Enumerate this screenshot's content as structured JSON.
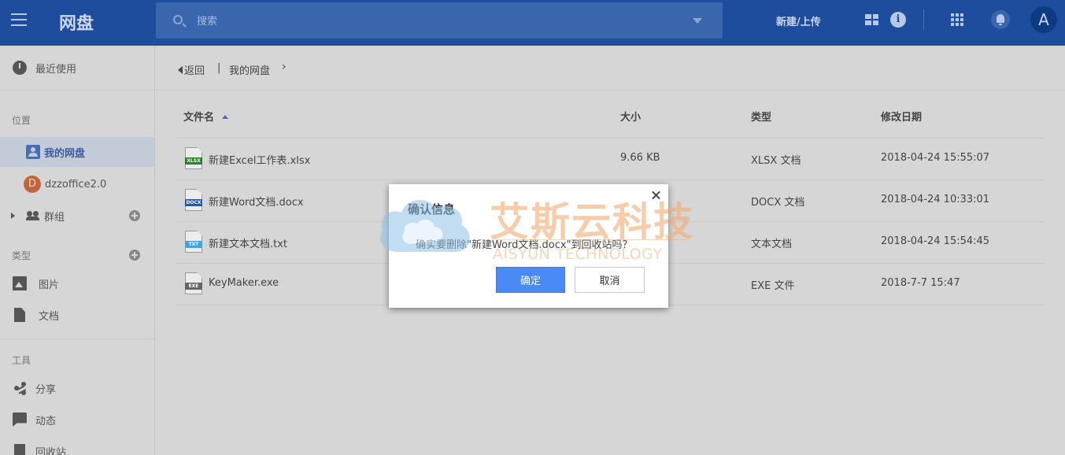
{
  "header": {
    "brand": "网盘",
    "search_placeholder": "搜索",
    "new_upload": "新建/上传",
    "info_glyph": "i",
    "avatar_letter": "A"
  },
  "sidebar": {
    "recent": "最近使用",
    "location_section": "位置",
    "my_drive": "我的网盘",
    "org_avatar": "D",
    "org_name": "dzzoffice2.0",
    "groups": "群组",
    "type_section": "类型",
    "images": "图片",
    "documents": "文档",
    "tools_section": "工具",
    "share": "分享",
    "activity": "动态",
    "recycle": "回收站"
  },
  "breadcrumb": {
    "back": "返回",
    "separator": "|",
    "root": "我的网盘",
    "chevron": "›"
  },
  "table": {
    "headers": {
      "name": "文件名",
      "size": "大小",
      "type": "类型",
      "modified": "修改日期"
    },
    "rows": [
      {
        "icon": "XLSX",
        "name": "新建Excel工作表.xlsx",
        "size": "9.66 KB",
        "type": "XLSX 文档",
        "modified": "2018-04-24 15:55:07"
      },
      {
        "icon": "DOCX",
        "name": "新建Word文档.docx",
        "size": "",
        "type": "DOCX 文档",
        "modified": "2018-04-24 10:33:01"
      },
      {
        "icon": "TXT",
        "name": "新建文本文档.txt",
        "size": "",
        "type": "文本文档",
        "modified": "2018-04-24 15:54:45"
      },
      {
        "icon": "EXE",
        "name": "KeyMaker.exe",
        "size": "",
        "type": "EXE 文件",
        "modified": "2018-7-7 15:47"
      }
    ]
  },
  "dialog": {
    "title": "确认信息",
    "message": "确实要删除\"新建Word文档.docx\"到回收站吗？",
    "ok": "确定",
    "cancel": "取消"
  },
  "watermark": {
    "cn": "艾斯云科技",
    "en": "AISYUN TECHNOLOGY"
  }
}
